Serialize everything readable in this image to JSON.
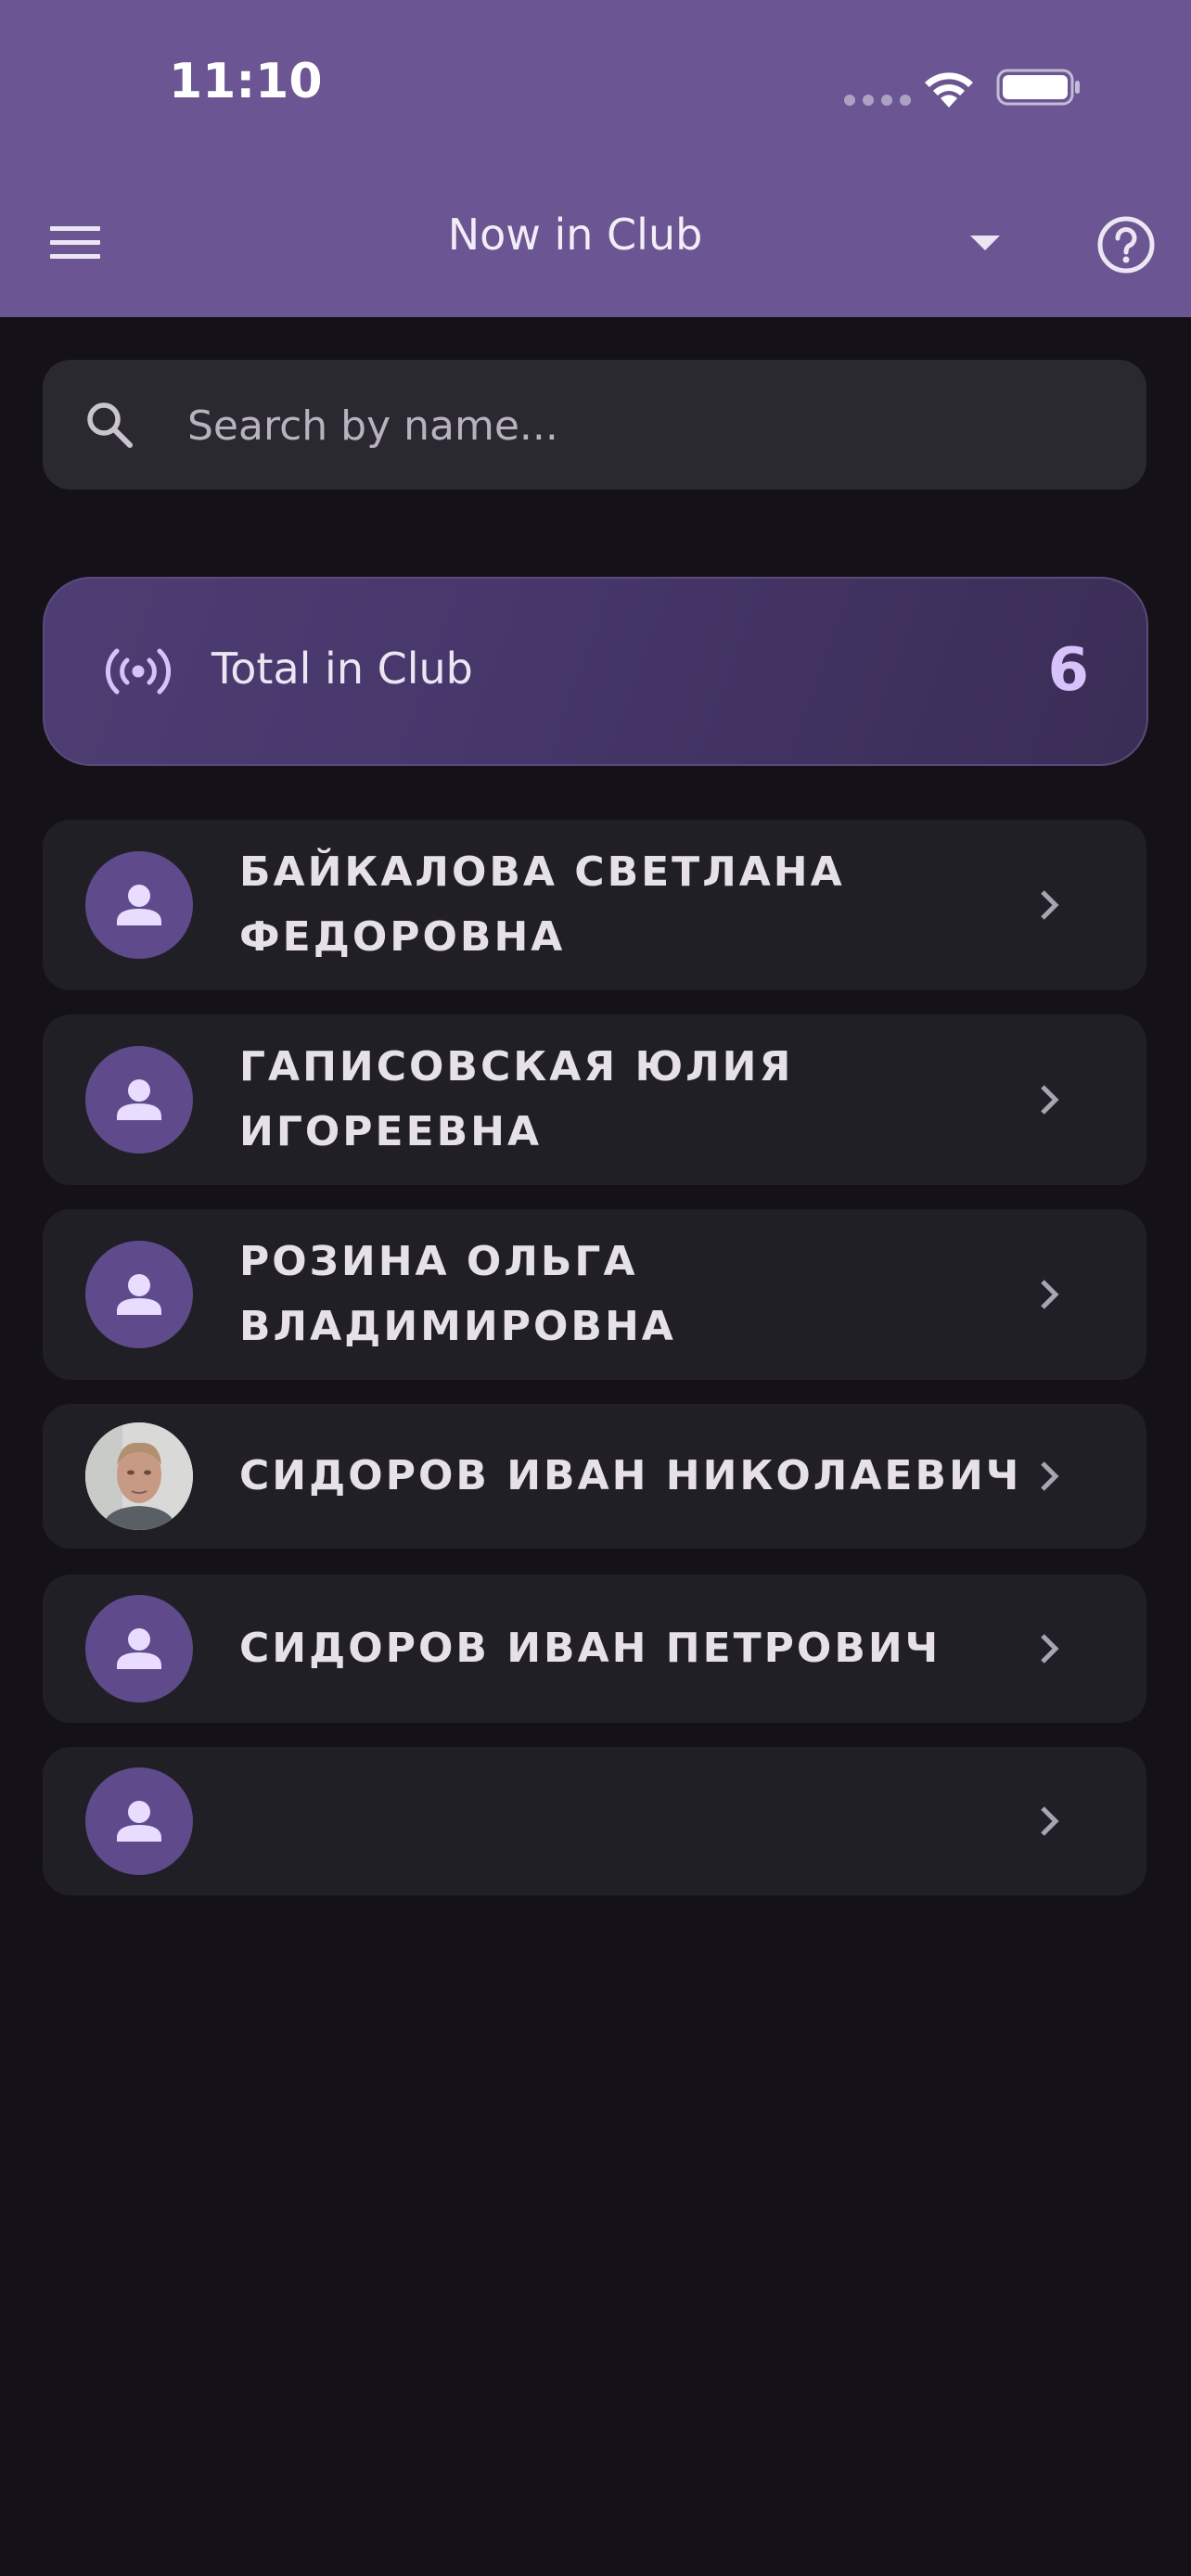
{
  "status_bar": {
    "time": "11:10"
  },
  "app_bar": {
    "title": "Now in Club",
    "menu_icon": "menu-icon",
    "dropdown_icon": "arrow-drop-down-icon",
    "help_icon": "help-circle-icon"
  },
  "search": {
    "placeholder": "Search by name...",
    "value": "",
    "icon": "search-icon"
  },
  "total": {
    "label": "Total in Club",
    "count": "6",
    "icon": "broadcast-icon"
  },
  "members": [
    {
      "name": "БАЙКАЛОВА СВЕТЛАНА\nФЕДОРОВНА",
      "avatar": "person-icon"
    },
    {
      "name": "ГАПИСОВСКАЯ  ЮЛИЯ\nИГОРЕЕВНА",
      "avatar": "person-icon"
    },
    {
      "name": "РОЗИНА ОЛЬГА\nВЛАДИМИРОВНА",
      "avatar": "person-icon"
    },
    {
      "name": "СИДОРОВ ИВАН НИКОЛАЕВИЧ",
      "avatar": "photo"
    },
    {
      "name": "СИДОРОВ ИВАН ПЕТРОВИЧ",
      "avatar": "person-icon"
    },
    {
      "name": "",
      "avatar": "person-icon"
    }
  ],
  "colors": {
    "app_bar": "#6b5593",
    "background": "#141218",
    "card": "#211f26",
    "accent": "#d7c2fb",
    "avatar": "#5f4a8b"
  }
}
